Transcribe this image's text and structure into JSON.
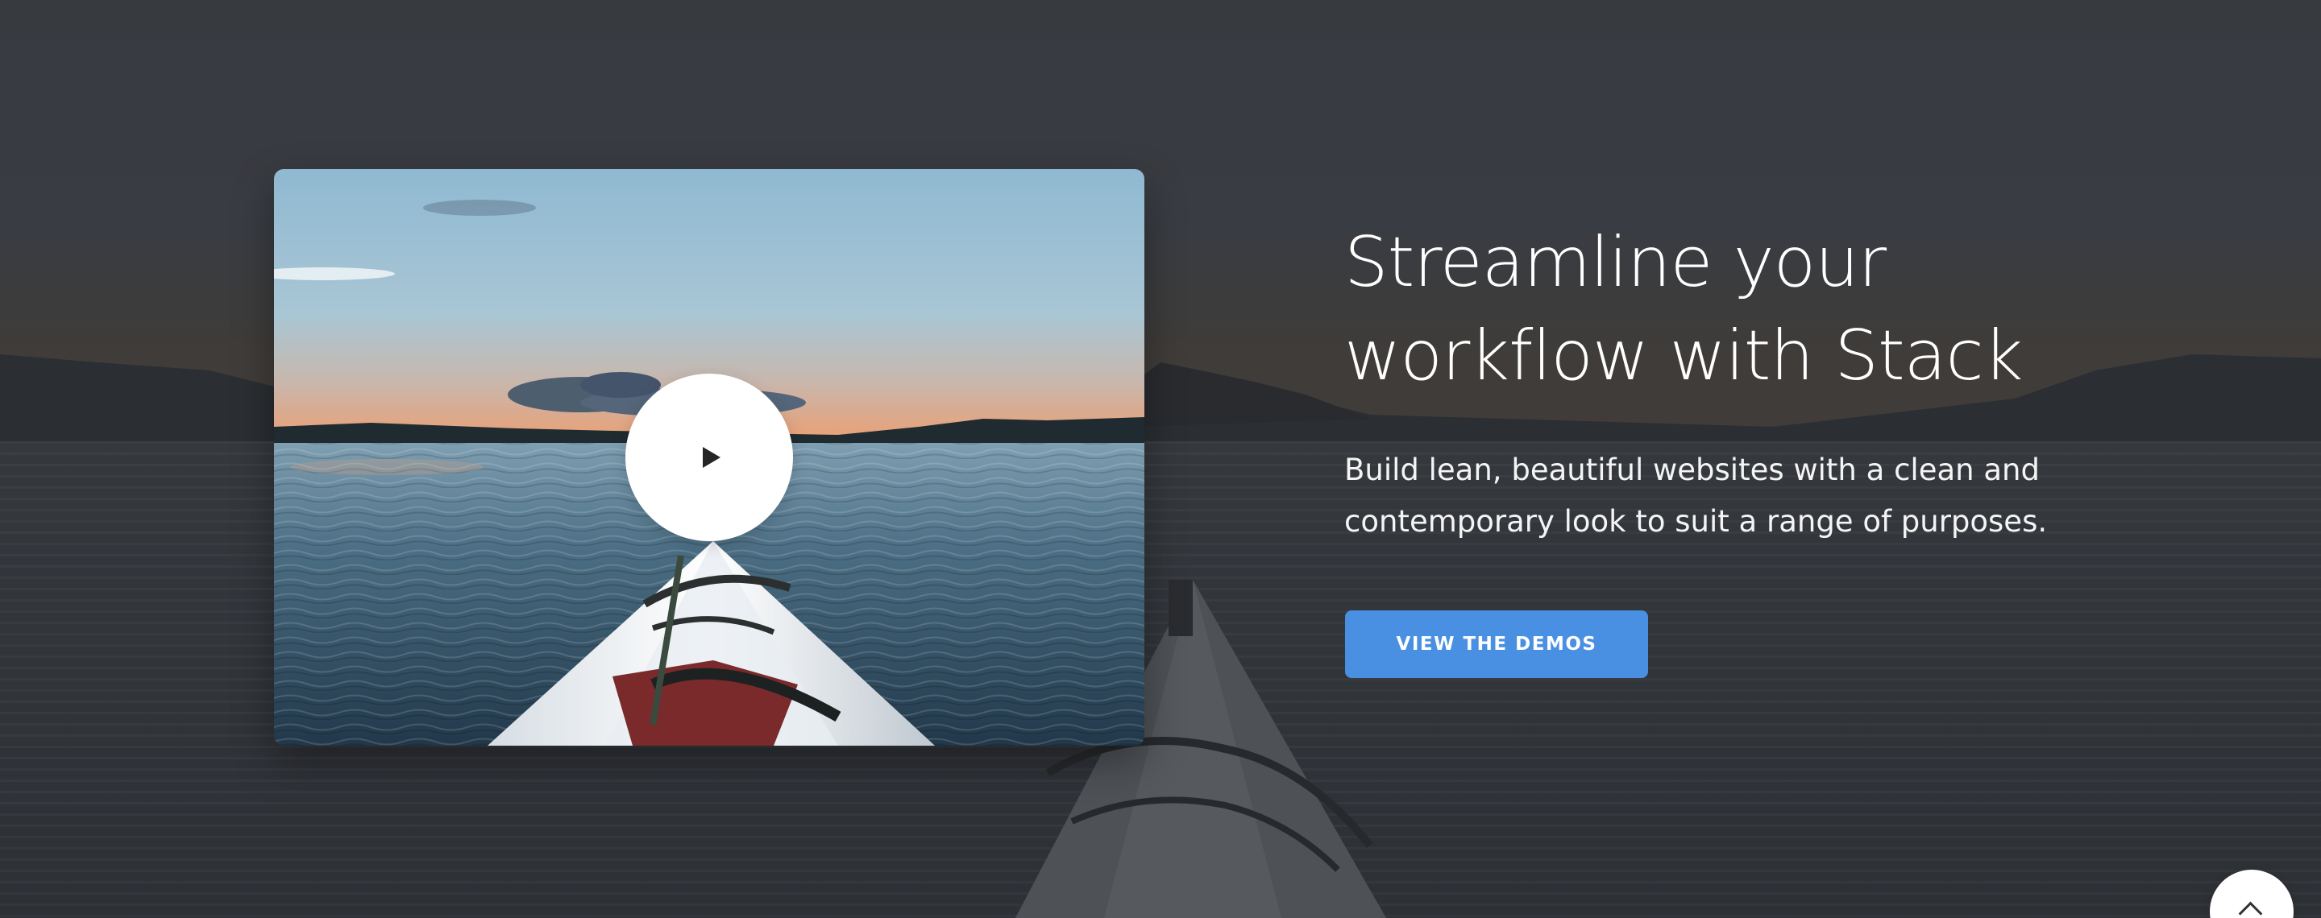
{
  "hero": {
    "headline_line1": "Streamline your",
    "headline_line2": "workflow with Stack",
    "subtext_line1": "Build lean, beautiful websites with a clean and",
    "subtext_line2": "contemporary look to suit a range of purposes.",
    "cta_label": "VIEW THE DEMOS"
  },
  "video": {
    "play_icon": "play-icon"
  },
  "back_to_top": {
    "icon": "chevron-up-icon"
  },
  "colors": {
    "accent": "#4a90e2",
    "background_overlay": "#3c4046",
    "text": "#ffffff"
  }
}
